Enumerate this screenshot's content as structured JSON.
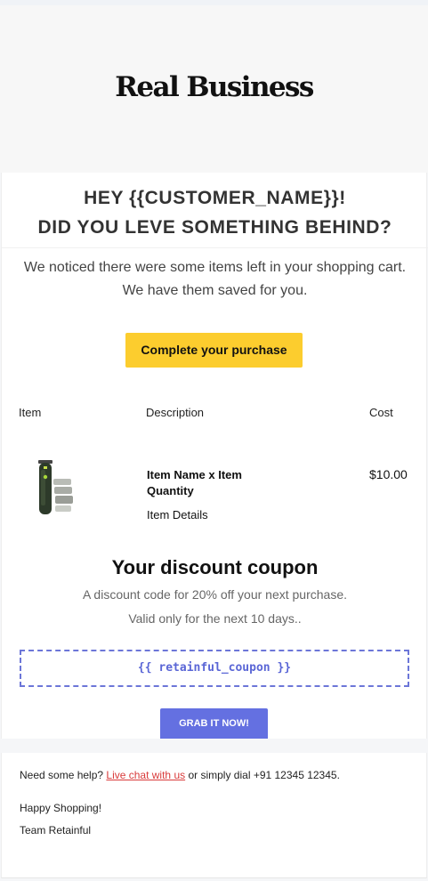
{
  "brand": {
    "logo_text": "Real Business",
    "accent_color": "#f5d53a"
  },
  "headline": {
    "line1": "HEY {{CUSTOMER_NAME}}!",
    "line2": "DID YOU LEVE SOMETHING BEHIND?"
  },
  "intro": {
    "line1": "We noticed there were some items left in your shopping cart.",
    "line2": "We have them saved for you."
  },
  "cta": {
    "label": "Complete your purchase",
    "color": "#fccd2e"
  },
  "cart": {
    "headers": {
      "item": "Item",
      "description": "Description",
      "cost": "Cost"
    },
    "items": [
      {
        "image_icon": "trimmer-product-image",
        "name": "Item Name x Item Quantity",
        "details": "Item Details",
        "cost": "$10.00"
      }
    ]
  },
  "coupon": {
    "title": "Your discount coupon",
    "line1": "A discount code for 20% off your next purchase.",
    "line2": "Valid only for the next 10 days..",
    "code": "{{ retainful_coupon }}",
    "button_label": "GRAB IT NOW!",
    "accent_color": "#6470e1"
  },
  "footer": {
    "help_prefix": "Need some help? ",
    "help_link": "Live chat with us",
    "help_suffix": " or simply dial +91 12345 12345.",
    "signoff1": "Happy Shopping!",
    "signoff2": "Team Retainful"
  }
}
